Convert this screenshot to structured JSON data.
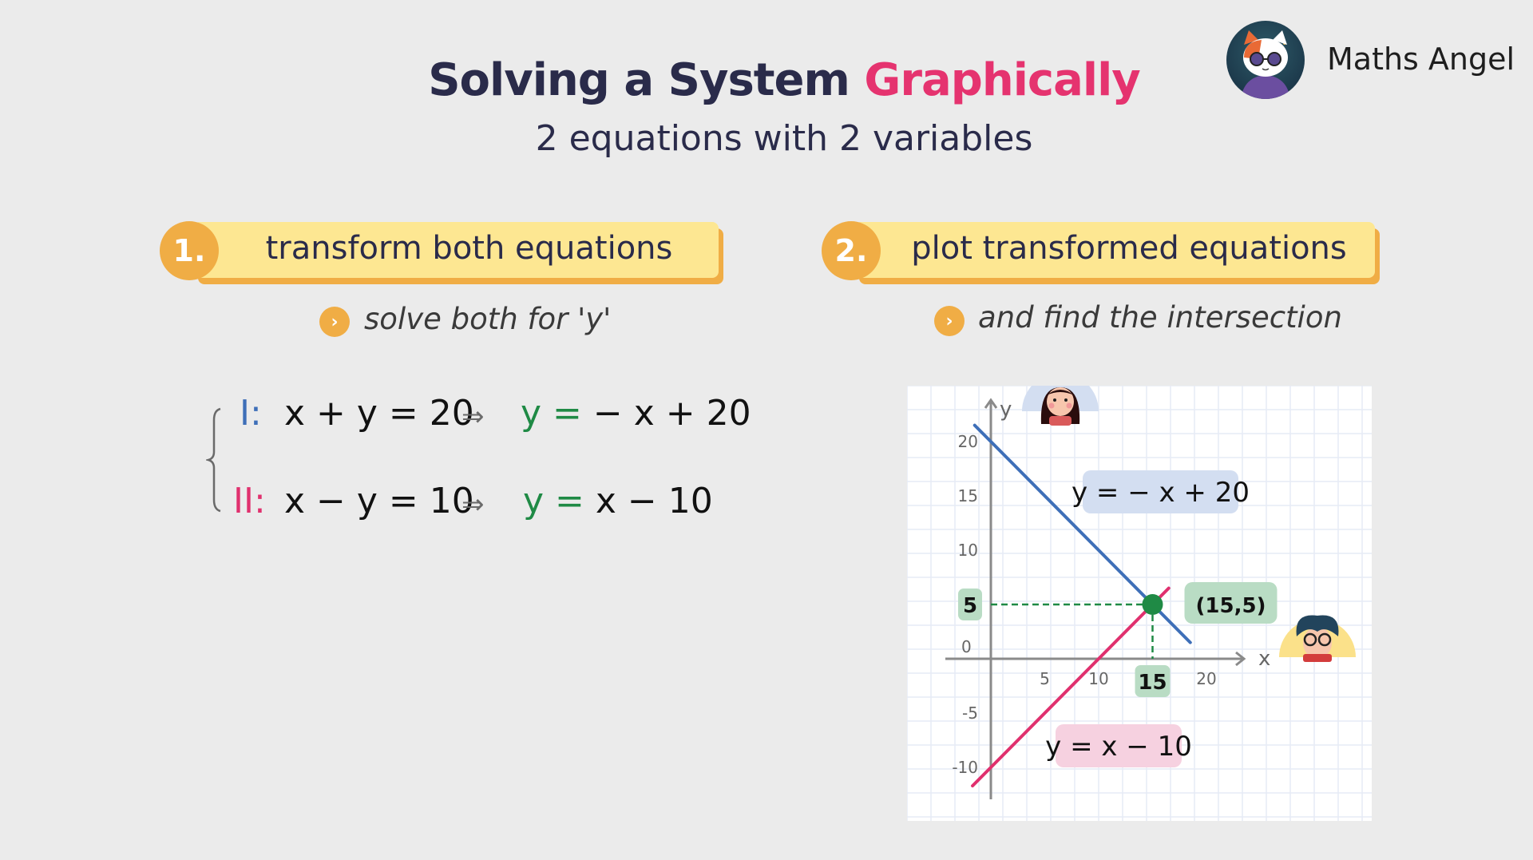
{
  "header": {
    "title_main": "Solving a System",
    "title_accent": "Graphically",
    "subtitle": "2 equations with 2 variables",
    "brand_name": "Maths Angel",
    "brand_logo_icon": "cat-with-sunglasses-logo"
  },
  "colors": {
    "title": "#2a2b4a",
    "accent": "#e5336f",
    "step_orange": "#f0ad45",
    "step_yellow": "#fde792",
    "equation_I": "#3e6fb8",
    "equation_II": "#e0306e",
    "solved_y": "#1f8a45",
    "intersection": "#1f8a45"
  },
  "steps": [
    {
      "number": "1.",
      "label": "transform both equations",
      "bullet_icon": "chevron-right-icon",
      "bullet": "solve both for 'y'"
    },
    {
      "number": "2.",
      "label": "plot transformed equations",
      "bullet_icon": "chevron-right-icon",
      "bullet": "and find the intersection"
    }
  ],
  "system": {
    "arrow": "⇒",
    "equations": [
      {
        "id": "I:",
        "original": "x + y = 20",
        "solved_lhs": "y =",
        "solved_rhs": "− x + 20"
      },
      {
        "id": "II:",
        "original": "x − y = 10",
        "solved_lhs": "y =",
        "solved_rhs": "x − 10"
      }
    ]
  },
  "chart_data": {
    "type": "line",
    "title": "",
    "xlabel": "x",
    "ylabel": "y",
    "xlim": [
      -3,
      27
    ],
    "ylim": [
      -13,
      22
    ],
    "grid": true,
    "x_ticks": [
      5,
      10,
      15,
      20
    ],
    "y_ticks": [
      20,
      15,
      10,
      0,
      -5,
      -10
    ],
    "origin_label": "0",
    "series": [
      {
        "name": "y = − x + 20",
        "slope": -1,
        "intercept": 20,
        "x_range": [
          -1.5,
          18.5
        ],
        "color": "#3e6fb8",
        "label_position": "upper-right"
      },
      {
        "name": "y = x − 10",
        "slope": 1,
        "intercept": -10,
        "x_range": [
          -1.7,
          16.5
        ],
        "color": "#e0306e",
        "label_position": "lower-middle"
      }
    ],
    "intersection": {
      "x": 15,
      "y": 5,
      "label": "(15,5)",
      "x_badge": "15",
      "y_badge": "5",
      "color": "#1f8a45"
    },
    "avatars": [
      "girl-avatar",
      "boy-with-glasses-avatar"
    ]
  }
}
